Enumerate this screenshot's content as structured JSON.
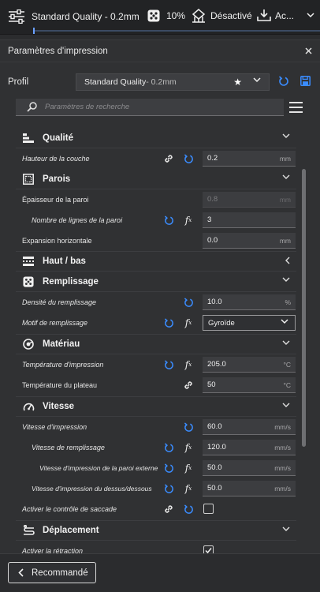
{
  "topbar": {
    "profile": "Standard Quality - 0.2mm",
    "infill": "10%",
    "support": "Désactivé",
    "adhesion": "Ac..."
  },
  "panel": {
    "title": "Paramètres d'impression",
    "profile_label": "Profil",
    "profile_name": "Standard Quality",
    "profile_suffix": " - 0.2mm",
    "search_placeholder": "Paramètres de recherche"
  },
  "categories": {
    "quality": "Qualité",
    "walls": "Parois",
    "topbottom": "Haut / bas",
    "infill": "Remplissage",
    "material": "Matériau",
    "speed": "Vitesse",
    "travel": "Déplacement"
  },
  "settings": {
    "layer_height": {
      "label": "Hauteur de la couche",
      "value": "0.2",
      "unit": "mm"
    },
    "wall_thickness": {
      "label": "Épaisseur de la paroi",
      "value": "0.8",
      "unit": "mm"
    },
    "wall_line_count": {
      "label": "Nombre de lignes de la paroi",
      "value": "3"
    },
    "horizontal_expansion": {
      "label": "Expansion horizontale",
      "value": "0.0",
      "unit": "mm"
    },
    "infill_density": {
      "label": "Densité du remplissage",
      "value": "10.0",
      "unit": "%"
    },
    "infill_pattern": {
      "label": "Motif de remplissage",
      "value": "Gyroïde"
    },
    "print_temp": {
      "label": "Température d'impression",
      "value": "205.0",
      "unit": "°C"
    },
    "bed_temp": {
      "label": "Température du plateau",
      "value": "50",
      "unit": "°C"
    },
    "print_speed": {
      "label": "Vitesse d'impression",
      "value": "60.0",
      "unit": "mm/s"
    },
    "infill_speed": {
      "label": "Vitesse de remplissage",
      "value": "120.0",
      "unit": "mm/s"
    },
    "outer_wall_speed": {
      "label": "Vitesse d'impression de la paroi externe",
      "value": "50.0",
      "unit": "mm/s"
    },
    "topbottom_speed": {
      "label": "Vitesse d'impression du dessus/dessous",
      "value": "50.0",
      "unit": "mm/s"
    },
    "jerk_control": {
      "label": "Activer le contrôle de saccade"
    },
    "retraction": {
      "label": "Activer la rétraction"
    }
  },
  "bottom": {
    "recommended": "Recommandé"
  },
  "colors": {
    "accent_blue": "#3a8cff",
    "background": "#303133"
  }
}
